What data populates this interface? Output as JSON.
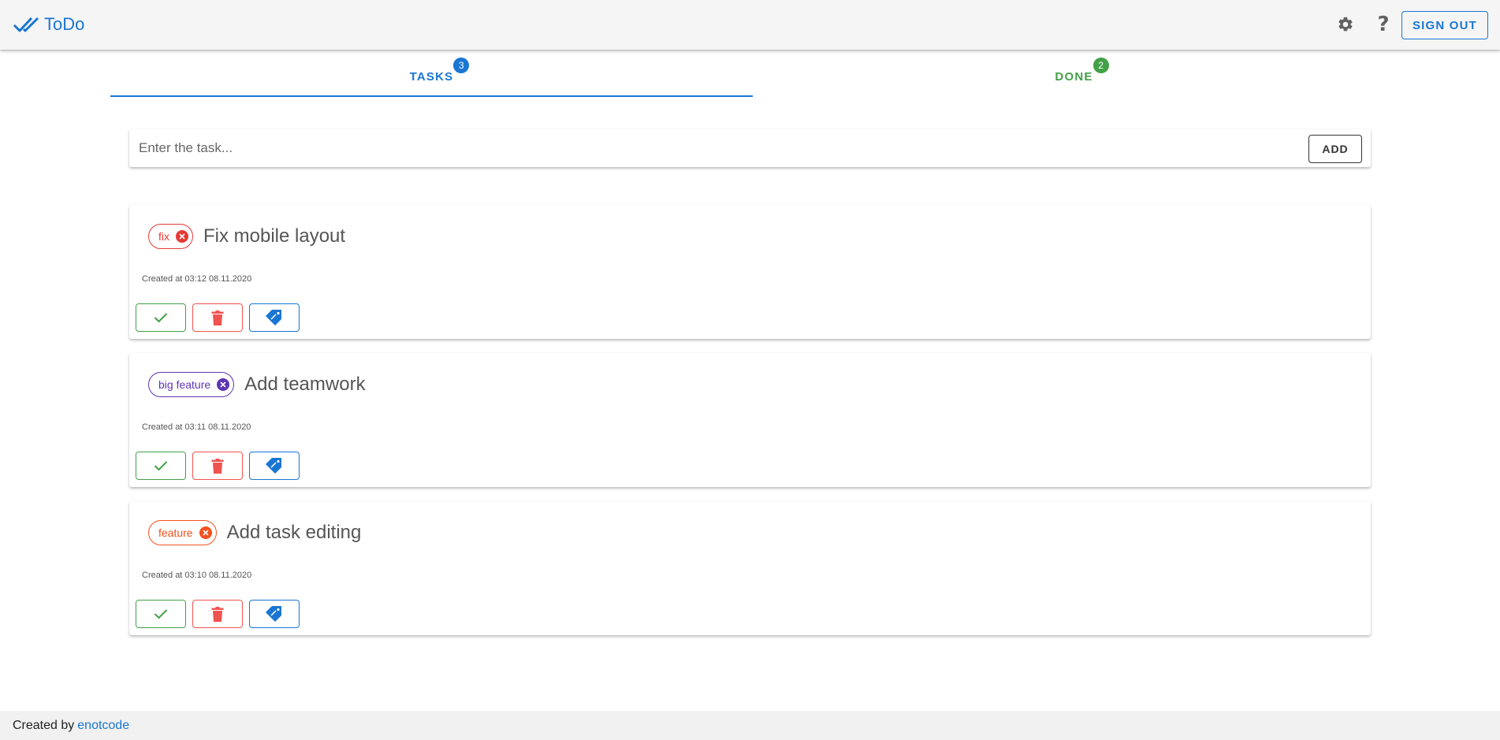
{
  "app": {
    "title": "ToDo",
    "logo_icon": "double-check-icon",
    "brand_color": "#1976d2"
  },
  "header": {
    "settings_icon": "gear-icon",
    "help_icon": "help-icon",
    "help_glyph": "?",
    "signout_label": "SIGN OUT"
  },
  "tabs": [
    {
      "label": "TASKS",
      "count": "3",
      "color": "#1976d2",
      "selected": true
    },
    {
      "label": "DONE",
      "count": "2",
      "color": "#43a047",
      "selected": false
    }
  ],
  "add_task": {
    "placeholder": "Enter the task...",
    "value": "",
    "button_label": "ADD"
  },
  "tasks": [
    {
      "tag": "fix",
      "tag_color": "#e53935",
      "title": "Fix mobile layout",
      "created": "Created at 03:12 08.11.2020"
    },
    {
      "tag": "big feature",
      "tag_color": "#5e35b1",
      "title": "Add teamwork",
      "created": "Created at 03:11 08.11.2020"
    },
    {
      "tag": "feature",
      "tag_color": "#f4511e",
      "title": "Add task editing",
      "created": "Created at 03:10 08.11.2020"
    }
  ],
  "task_actions": [
    {
      "name": "mark-done-button",
      "icon": "check-icon",
      "color": "#43a047"
    },
    {
      "name": "delete-button",
      "icon": "trash-icon",
      "color": "#ef5350"
    },
    {
      "name": "tag-button",
      "icon": "tag-icon",
      "color": "#1976d2"
    }
  ],
  "footer": {
    "text": "Created by",
    "link_text": "enotcode"
  }
}
